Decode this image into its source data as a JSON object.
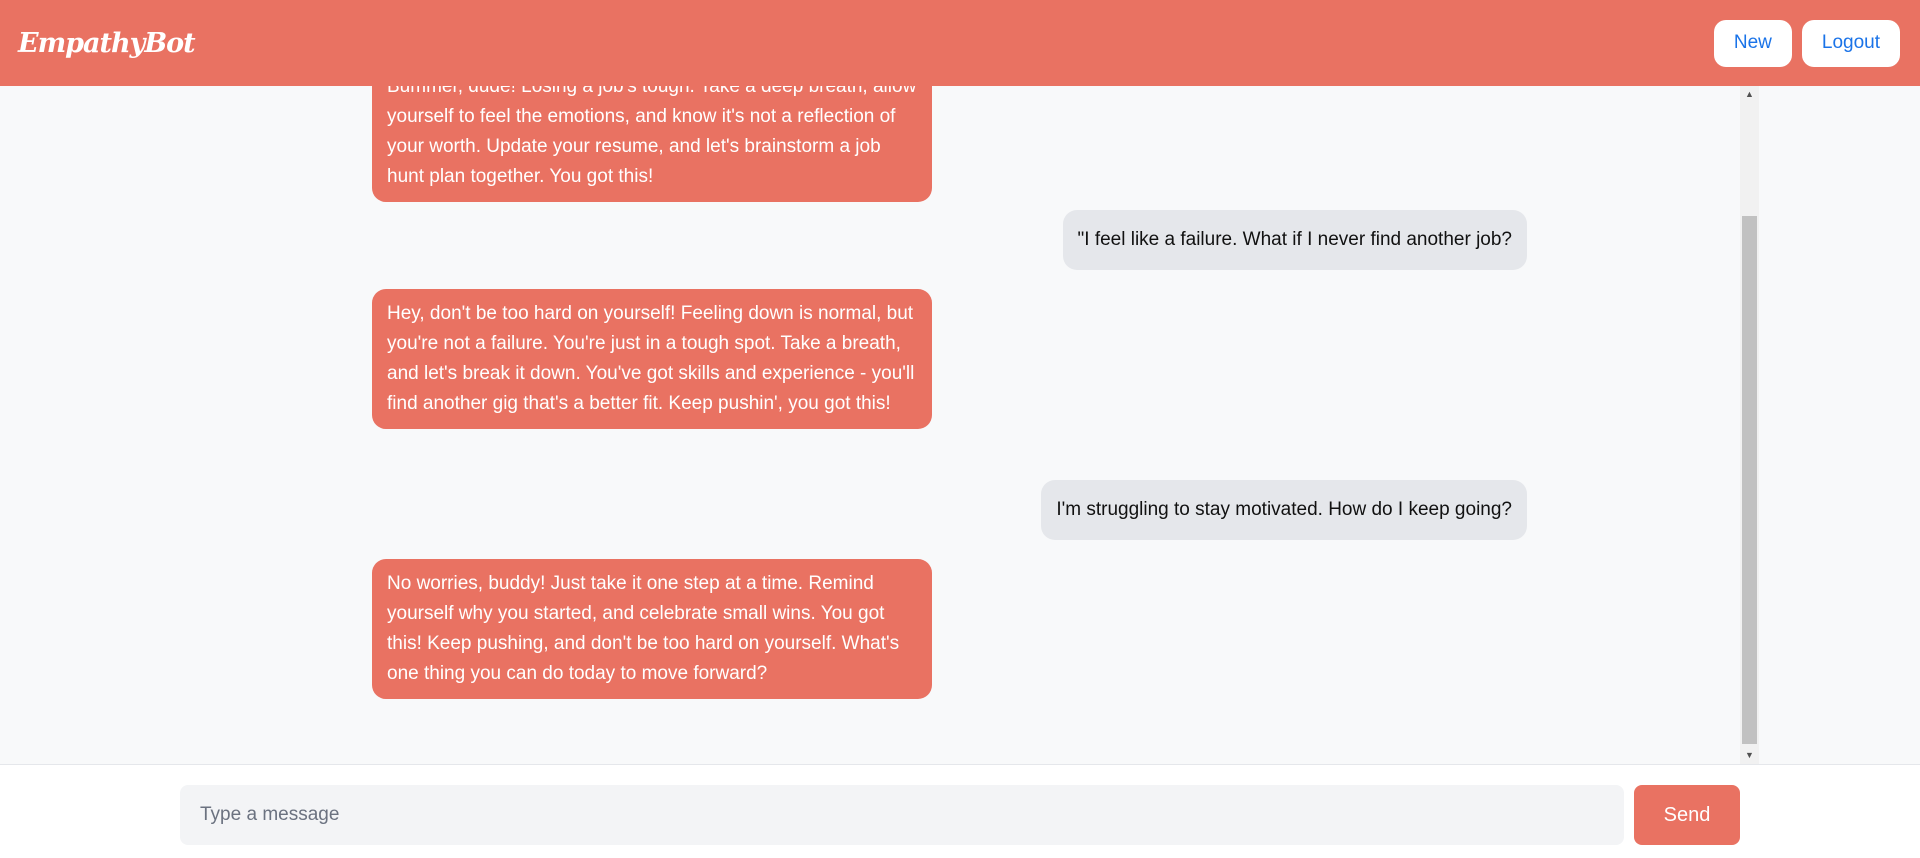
{
  "header": {
    "logo": "EmpathyBot",
    "new_label": "New",
    "logout_label": "Logout"
  },
  "messages": [
    {
      "role": "bot",
      "text": "Bummer, dude! Losing a job's tough. Take a deep breath, allow yourself to feel the emotions, and know it's not a reflection of your worth. Update your resume, and let's brainstorm a job hunt plan together. You got this!"
    },
    {
      "role": "user",
      "text": "\"I feel like a failure. What if I never find another job?"
    },
    {
      "role": "bot",
      "text": "Hey, don't be too hard on yourself! Feeling down is normal, but you're not a failure. You're just in a tough spot. Take a breath, and let's break it down. You've got skills and experience - you'll find another gig that's a better fit. Keep pushin', you got this!"
    },
    {
      "role": "user",
      "text": "I'm struggling to stay motivated. How do I keep going?"
    },
    {
      "role": "bot",
      "text": "No worries, buddy! Just take it one step at a time. Remind yourself why you started, and celebrate small wins. You got this! Keep pushing, and don't be too hard on yourself. What's one thing you can do today to move forward?"
    }
  ],
  "composer": {
    "placeholder": "Type a message",
    "send_label": "Send"
  },
  "icons": {
    "scroll_up": "scroll-up-arrow-icon",
    "scroll_down": "scroll-down-arrow-icon"
  },
  "colors": {
    "accent": "#e97262",
    "user_bubble": "#e5e7eb",
    "link_blue": "#1a73e8"
  }
}
